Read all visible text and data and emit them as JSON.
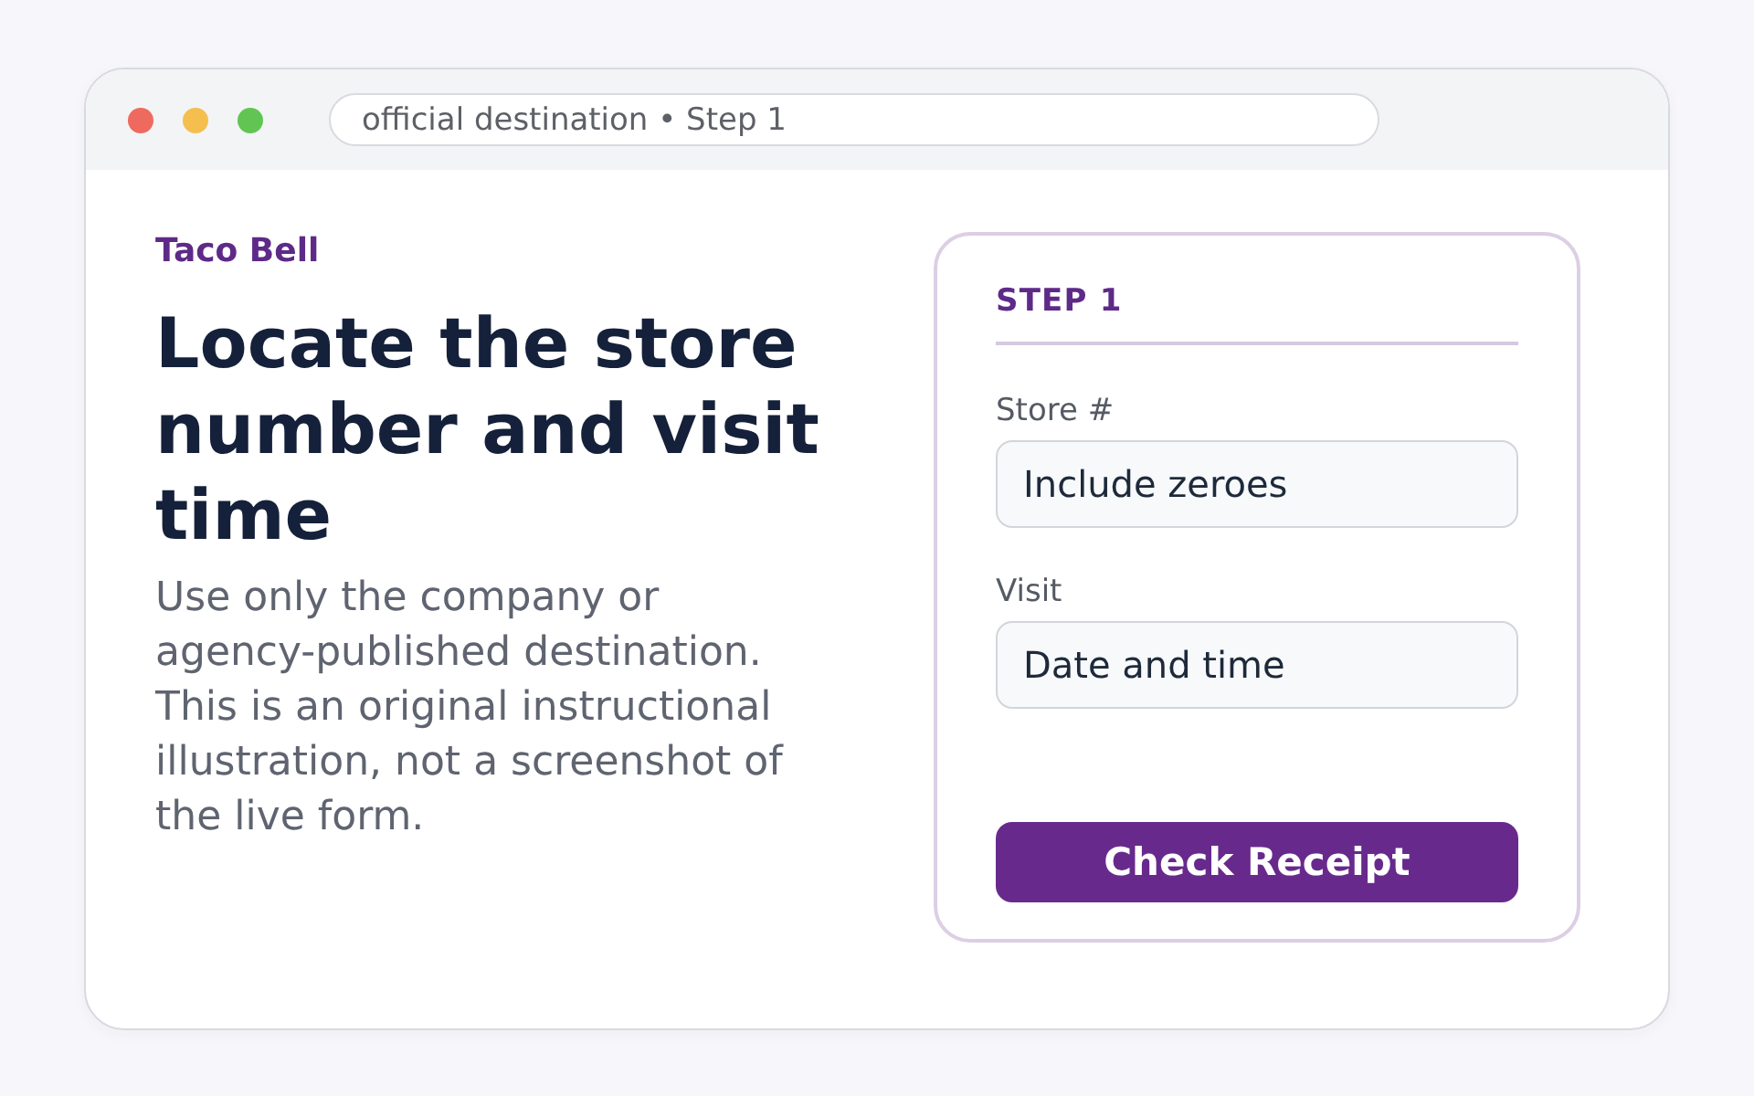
{
  "window": {
    "controls": [
      {
        "color": "#ee6a5f"
      },
      {
        "color": "#f4bf4f"
      },
      {
        "color": "#61c554"
      }
    ],
    "address_bar": {
      "text": "official destination • Step 1"
    }
  },
  "intro": {
    "brand": "Taco Bell",
    "heading": "Locate the store number and visit time",
    "description": "Use only the company or agency-published destination. This is an original instructional illustration, not a screenshot of the live form."
  },
  "form": {
    "step": "STEP 1",
    "fields": [
      {
        "label": "Store #",
        "placeholder": "Include zeroes"
      },
      {
        "label": "Visit",
        "placeholder": "Date and time"
      }
    ],
    "button": "Check Receipt"
  }
}
